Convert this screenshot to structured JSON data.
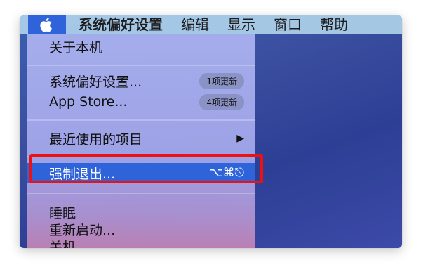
{
  "menubar": {
    "apple_icon": "apple-logo-icon",
    "items": [
      {
        "label": "系统偏好设置"
      },
      {
        "label": "编辑"
      },
      {
        "label": "显示"
      },
      {
        "label": "窗口"
      },
      {
        "label": "帮助"
      }
    ]
  },
  "apple_menu": {
    "items": [
      {
        "label": "关于本机"
      },
      {
        "label": "系统偏好设置...",
        "badge": "1项更新"
      },
      {
        "label": "App Store...",
        "badge": "4项更新"
      },
      {
        "label": "最近使用的项目",
        "submenu_icon": "triangle-right-icon"
      },
      {
        "label": "强制退出...",
        "shortcut": "⌥⌘⎋"
      },
      {
        "label": "睡眠"
      },
      {
        "label": "重新启动..."
      },
      {
        "label": "关机..."
      }
    ]
  },
  "colors": {
    "highlight": "#2f63d9",
    "annotation_box": "#ee1111"
  }
}
